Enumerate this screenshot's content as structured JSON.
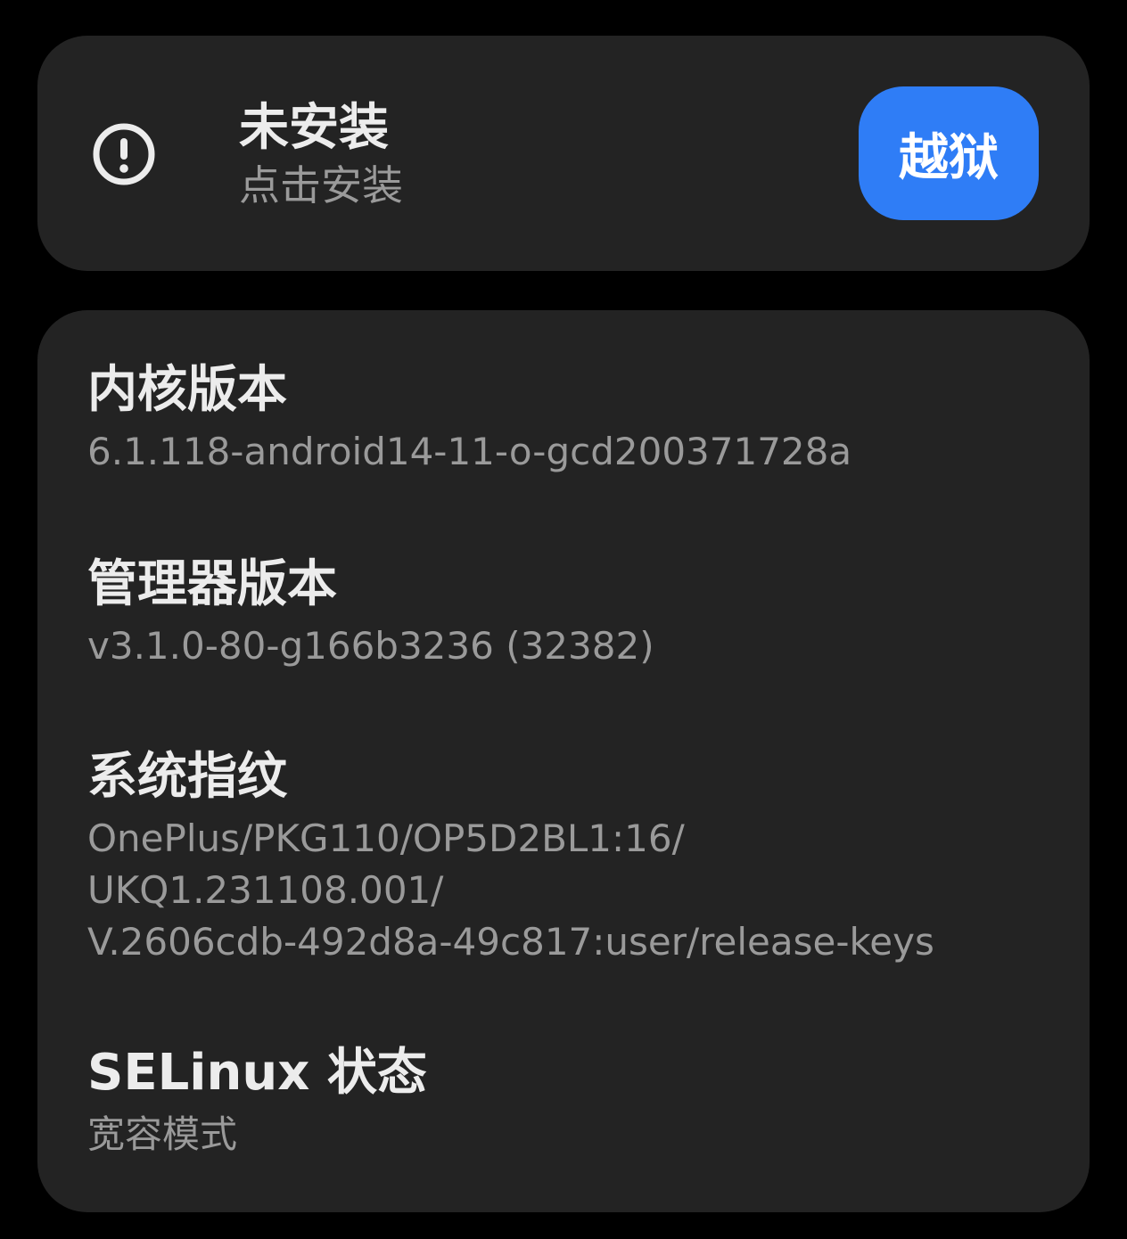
{
  "status_card": {
    "icon": "exclamation-circle-icon",
    "title": "未安装",
    "subtitle": "点击安装",
    "button_label": "越狱",
    "button_color": "#2f7df6"
  },
  "info_card": {
    "items": [
      {
        "label": "内核版本",
        "value": "6.1.118-android14-11-o-gcd200371728a"
      },
      {
        "label": "管理器版本",
        "value": "v3.1.0-80-g166b3236 (32382)"
      },
      {
        "label": "系统指纹",
        "value": "OnePlus/PKG110/OP5D2BL1:16/\nUKQ1.231108.001/\nV.2606cdb-492d8a-49c817:user/release-keys"
      },
      {
        "label": "SELinux 状态",
        "value": "宽容模式"
      }
    ]
  }
}
